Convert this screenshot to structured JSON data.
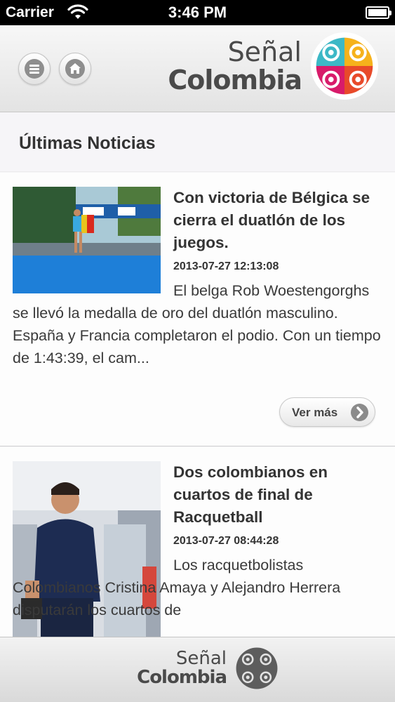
{
  "status_bar": {
    "carrier": "Carrier",
    "time": "3:46 PM"
  },
  "header": {
    "brand_line1": "Señal",
    "brand_line2": "Colombia",
    "menu_icon": "menu-icon",
    "home_icon": "home-icon"
  },
  "section": {
    "title": "Últimas Noticias"
  },
  "articles": [
    {
      "title": "Con victoria de Bélgica se cierra el duatlón de los juegos.",
      "date": "2013-07-27 12:13:08",
      "summary": "El belga Rob Woestengorghs se llevó la medalla de oro del duatlón masculino. España y Francia completaron el podio. Con un tiempo de 1:43:39, el cam...",
      "more_label": "Ver más"
    },
    {
      "title": "Dos colombianos en cuartos de final de Racquetball",
      "date": "2013-07-27 08:44:28",
      "summary": "Los racquetbolistas Colombianos Cristina Amaya y Alejandro Herrera disputarán los cuartos de"
    }
  ],
  "footer": {
    "brand_line1": "Señal",
    "brand_line2": "Colombia"
  },
  "colors": {
    "header_bg": "#ececec",
    "button_icon": "#8e8e8e",
    "text": "#333333"
  }
}
